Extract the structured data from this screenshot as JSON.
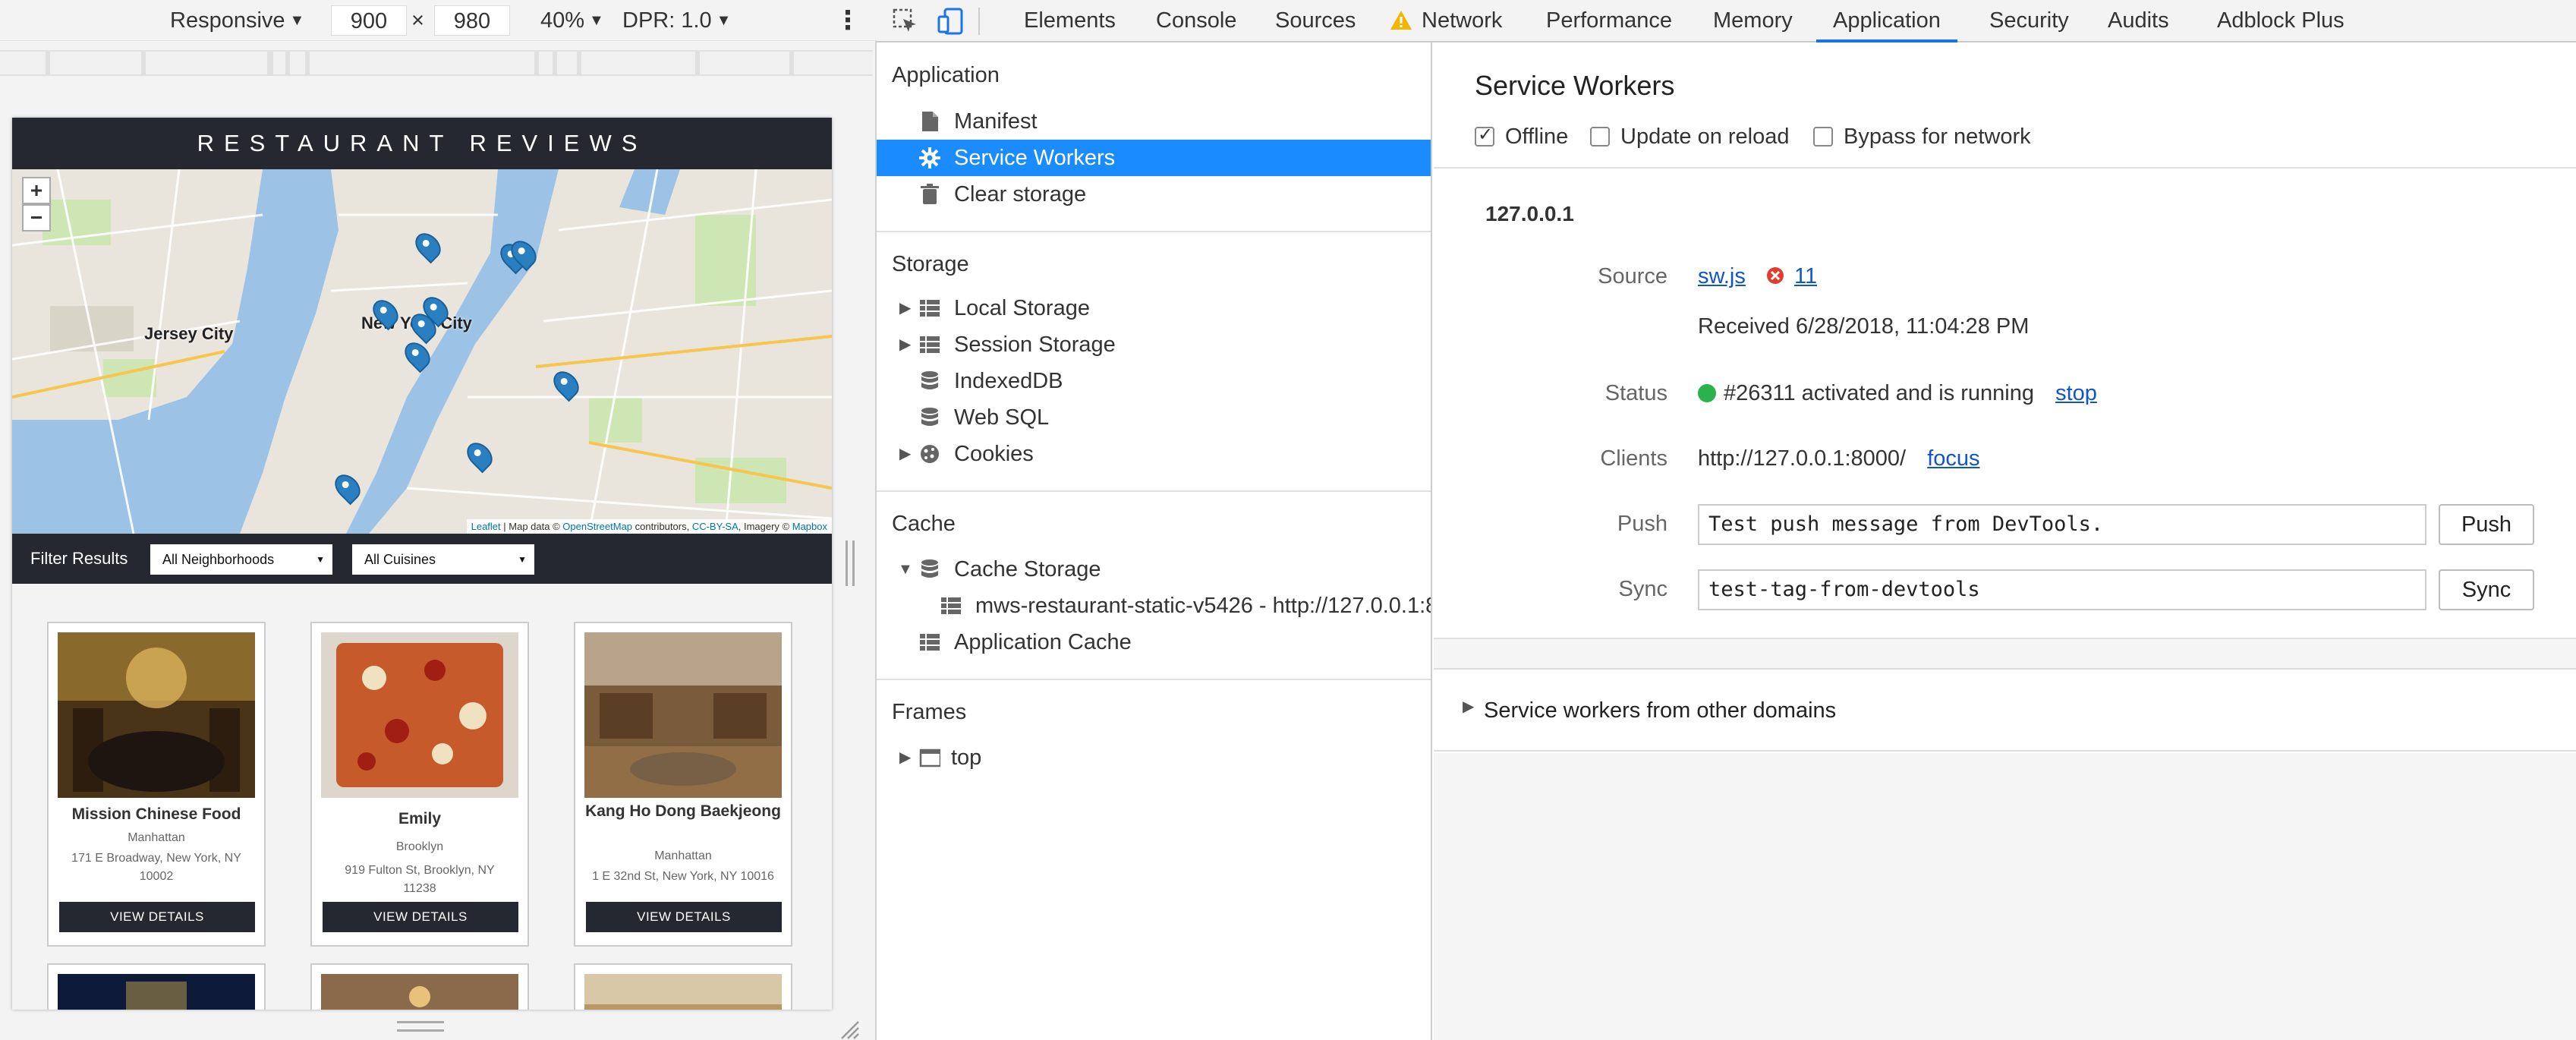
{
  "emulation": {
    "device": "Responsive",
    "width": "900",
    "times": "×",
    "height": "980",
    "zoom": "40%",
    "dpr": "DPR: 1.0",
    "more": "⋮"
  },
  "site": {
    "title": "RESTAURANT REVIEWS",
    "map": {
      "zoom_in": "+",
      "zoom_out": "−",
      "labels": [
        "Jersey City",
        "New York City"
      ],
      "attribution": {
        "leaflet": "Leaflet",
        "sep1": " | Map data © ",
        "osm": "OpenStreetMap",
        "contrib": " contributors, ",
        "ccbysa": "CC-BY-SA",
        "imagery": ", Imagery © ",
        "mapbox": "Mapbox"
      }
    },
    "filter": {
      "label": "Filter Results",
      "neighborhoods": "All Neighborhoods",
      "cuisines": "All Cuisines"
    },
    "restaurants": [
      {
        "name": "Mission Chinese Food",
        "neighborhood": "Manhattan",
        "address": "171 E Broadway, New York, NY 10002",
        "button": "VIEW DETAILS"
      },
      {
        "name": "Emily",
        "neighborhood": "Brooklyn",
        "address": "919 Fulton St, Brooklyn, NY 11238",
        "button": "VIEW DETAILS"
      },
      {
        "name": "Kang Ho Dong Baekjeong",
        "neighborhood": "Manhattan",
        "address": "1 E 32nd St, New York, NY 10016",
        "button": "VIEW DETAILS"
      }
    ]
  },
  "devtools": {
    "tabs": [
      "Elements",
      "Console",
      "Sources",
      "Network",
      "Performance",
      "Memory",
      "Application",
      "Security",
      "Audits",
      "Adblock Plus"
    ],
    "active_tab": "Application",
    "sidebar": {
      "application_header": "Application",
      "application_items": [
        "Manifest",
        "Service Workers",
        "Clear storage"
      ],
      "storage_header": "Storage",
      "storage_items": [
        "Local Storage",
        "Session Storage",
        "IndexedDB",
        "Web SQL",
        "Cookies"
      ],
      "cache_header": "Cache",
      "cache_items": [
        "Cache Storage",
        "mws-restaurant-static-v5426 - http://127.0.0.1:8",
        "Application Cache"
      ],
      "frames_header": "Frames",
      "frames_items": [
        "top"
      ]
    },
    "service_workers": {
      "title": "Service Workers",
      "offline": "Offline",
      "update_on_reload": "Update on reload",
      "bypass_for_network": "Bypass for network",
      "host": "127.0.0.1",
      "source_label": "Source",
      "source_file": "sw.js",
      "error_count": "11",
      "received": "Received 6/28/2018, 11:04:28 PM",
      "status_label": "Status",
      "status_text": "#26311 activated and is running",
      "stop": "stop",
      "clients_label": "Clients",
      "clients_url": "http://127.0.0.1:8000/",
      "focus": "focus",
      "push_label": "Push",
      "push_value": "Test push message from DevTools.",
      "push_button": "Push",
      "sync_label": "Sync",
      "sync_value": "test-tag-from-devtools",
      "sync_button": "Sync",
      "other_domains": "Service workers from other domains"
    }
  },
  "colors": {
    "accent": "#1a8cff",
    "site_dark": "#252831",
    "link": "#1155cc",
    "status_green": "#2bb24c",
    "error_red": "#e03c31",
    "warning": "#f2b600"
  }
}
